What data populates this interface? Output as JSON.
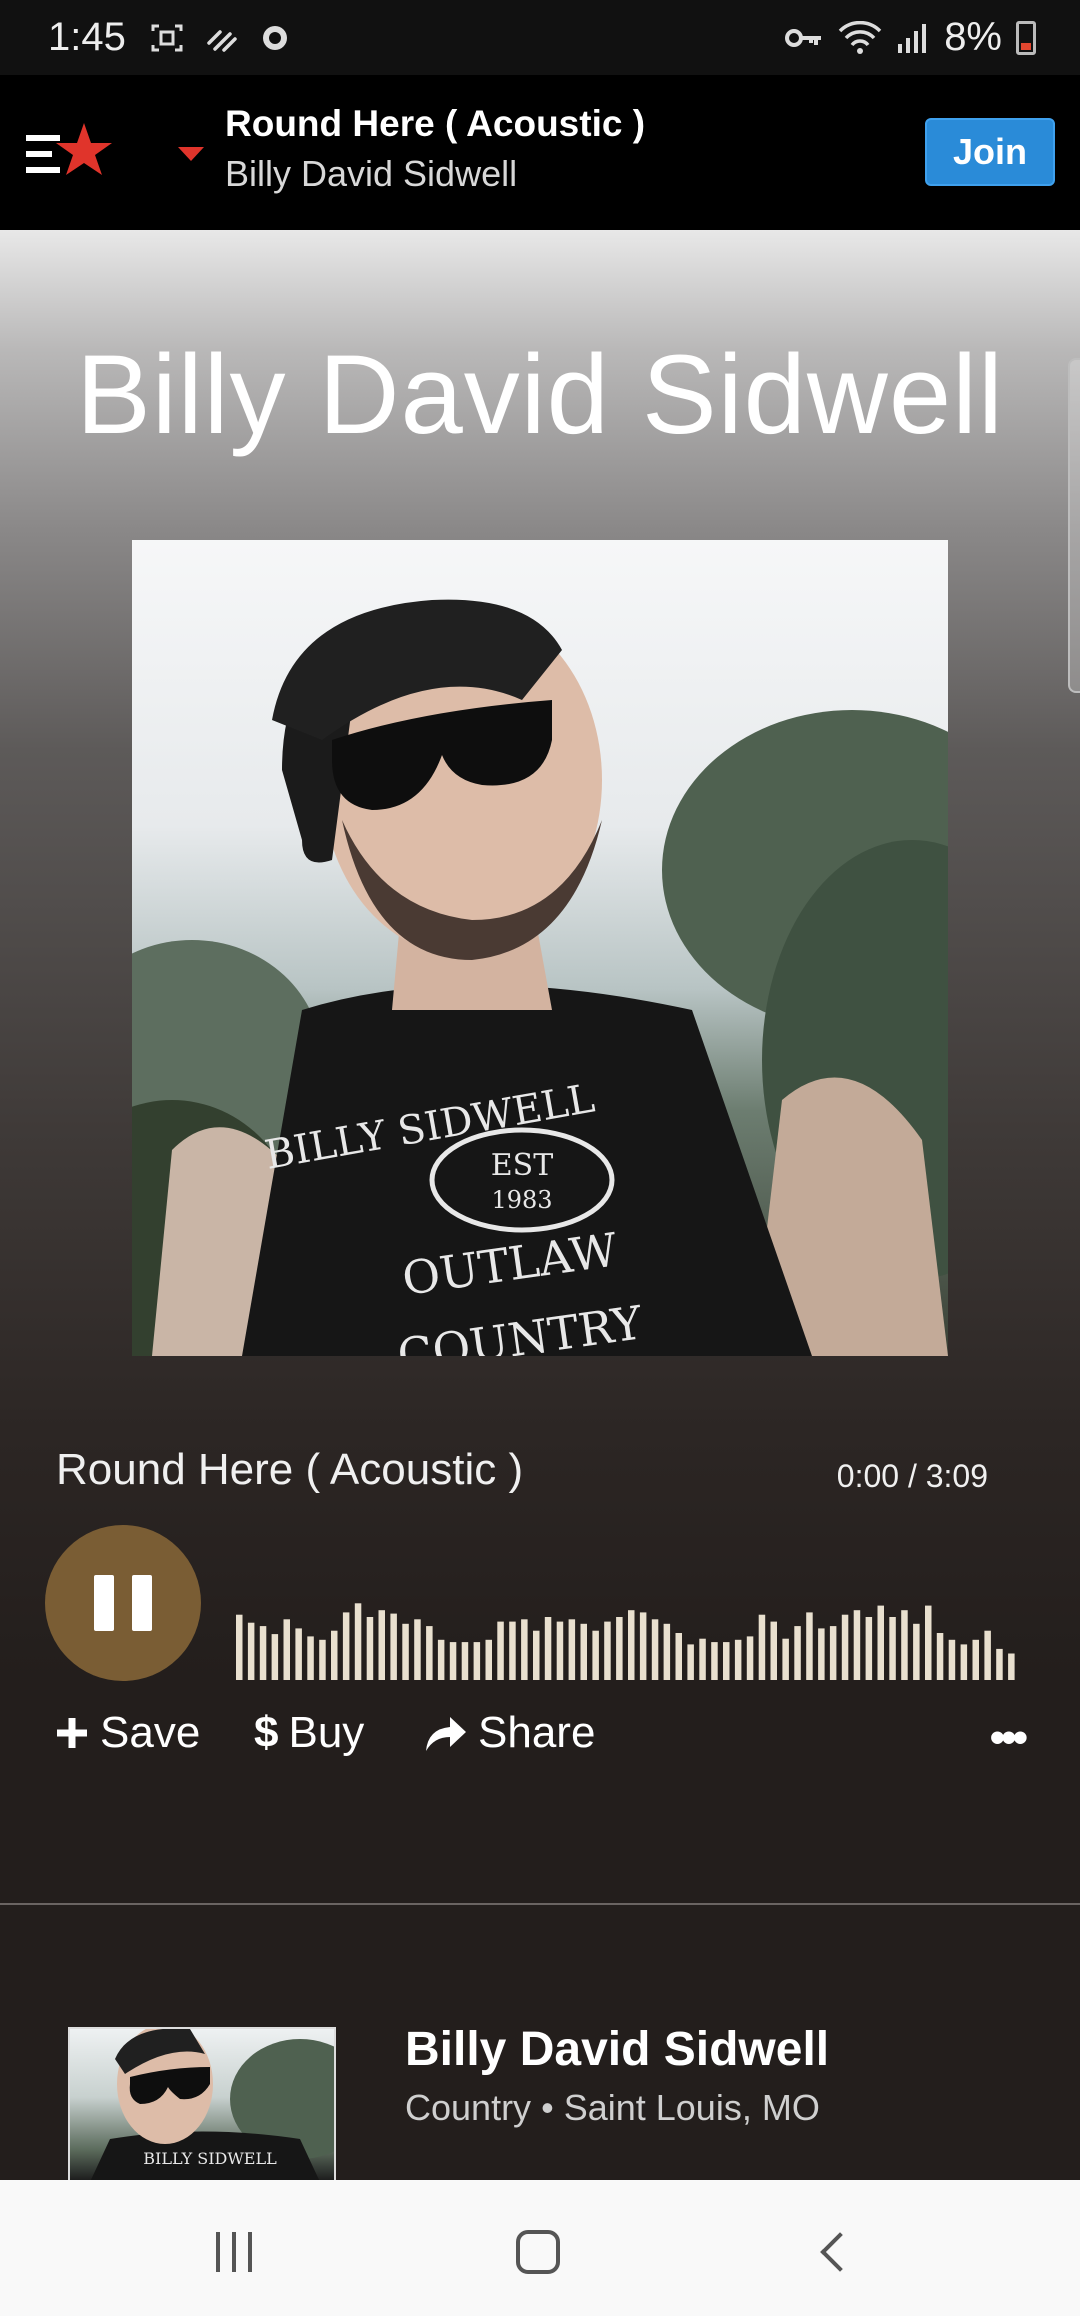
{
  "status_bar": {
    "time": "1:45",
    "battery_percent": "8%",
    "icons": [
      "screenshot-icon",
      "data-saver-icon",
      "sync-icon",
      "vpn-key-icon",
      "wifi-icon",
      "signal-icon",
      "battery-icon"
    ]
  },
  "header": {
    "song_title": "Round Here ( Acoustic )",
    "artist": "Billy David Sidwell",
    "join_label": "Join",
    "logo_icon": "reverbnation-star-icon",
    "accent_color": "#e0342b",
    "join_color": "#2a8bd8"
  },
  "hero": {
    "artist_name": "Billy David Sidwell",
    "cover_shirt_text": [
      "BILLY SIDWELL",
      "EST",
      "1983",
      "OUTLAW",
      "COUNTRY"
    ]
  },
  "player": {
    "track_title": "Round Here ( Acoustic )",
    "elapsed": "0:00",
    "separator": "/",
    "duration": "3:09",
    "play_state": "playing",
    "progress": 0,
    "button_color": "#7a5d34",
    "waveform_color": "#e9e0cf",
    "waveform_levels": [
      0.52,
      0.45,
      0.42,
      0.35,
      0.48,
      0.4,
      0.33,
      0.3,
      0.38,
      0.54,
      0.62,
      0.5,
      0.56,
      0.53,
      0.44,
      0.48,
      0.42,
      0.3,
      0.28,
      0.28,
      0.28,
      0.3,
      0.46,
      0.46,
      0.48,
      0.38,
      0.5,
      0.46,
      0.48,
      0.44,
      0.38,
      0.46,
      0.5,
      0.56,
      0.54,
      0.48,
      0.44,
      0.36,
      0.26,
      0.31,
      0.28,
      0.28,
      0.3,
      0.33,
      0.52,
      0.46,
      0.31,
      0.42,
      0.54,
      0.4,
      0.42,
      0.52,
      0.56,
      0.5,
      0.6,
      0.5,
      0.56,
      0.44,
      0.6,
      0.36,
      0.3,
      0.26,
      0.3,
      0.38,
      0.22,
      0.18
    ],
    "actions": [
      {
        "label": "Save",
        "icon": "plus-icon"
      },
      {
        "label": "Buy",
        "icon": "dollar-icon"
      },
      {
        "label": "Share",
        "icon": "share-arrow-icon"
      }
    ],
    "more_icon": "more-dots-icon"
  },
  "artist_card": {
    "name": "Billy David Sidwell",
    "genre": "Country",
    "bullet": "•",
    "location": "Saint Louis, MO"
  },
  "navbar": {
    "icons": [
      "recents-icon",
      "home-icon",
      "back-icon"
    ]
  }
}
